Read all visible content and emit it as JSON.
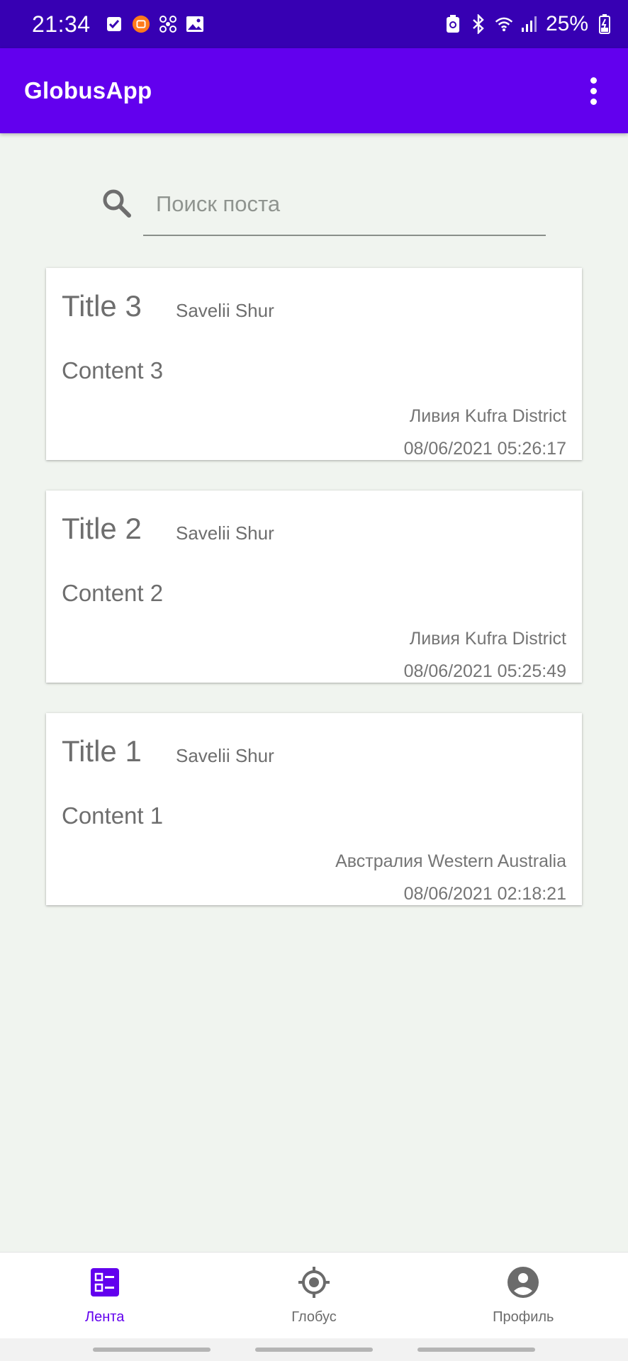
{
  "status_bar": {
    "time": "21:34",
    "battery_percent": "25%",
    "left_icons": [
      "check-icon",
      "mi-app-icon",
      "fan-icon",
      "image-icon"
    ],
    "right_icons": [
      "battery-saver-icon",
      "bluetooth-icon",
      "wifi-icon",
      "signal-icon",
      "battery-icon"
    ]
  },
  "app_bar": {
    "title": "GlobusApp",
    "menu_icon": "more-vert-icon"
  },
  "search": {
    "placeholder": "Поиск поста",
    "value": ""
  },
  "posts": [
    {
      "title": "Title 3",
      "author": "Savelii Shur",
      "content": "Content 3",
      "location": "Ливия Kufra District",
      "date": "08/06/2021 05:26:17"
    },
    {
      "title": "Title 2",
      "author": "Savelii Shur",
      "content": "Content 2",
      "location": "Ливия Kufra District",
      "date": "08/06/2021 05:25:49"
    },
    {
      "title": "Title 1",
      "author": "Savelii Shur",
      "content": "Content 1",
      "location": "Австралия Western Australia",
      "date": "08/06/2021 02:18:21"
    }
  ],
  "bottom_nav": {
    "items": [
      {
        "label": "Лента",
        "icon": "feed-list-icon",
        "active": true
      },
      {
        "label": "Глобус",
        "icon": "globe-target-icon",
        "active": false
      },
      {
        "label": "Профиль",
        "icon": "profile-icon",
        "active": false
      }
    ]
  },
  "colors": {
    "status_bar": "#3700b3",
    "app_bar": "#6200ee",
    "accent": "#6200ee",
    "background": "#f0f4ef"
  }
}
